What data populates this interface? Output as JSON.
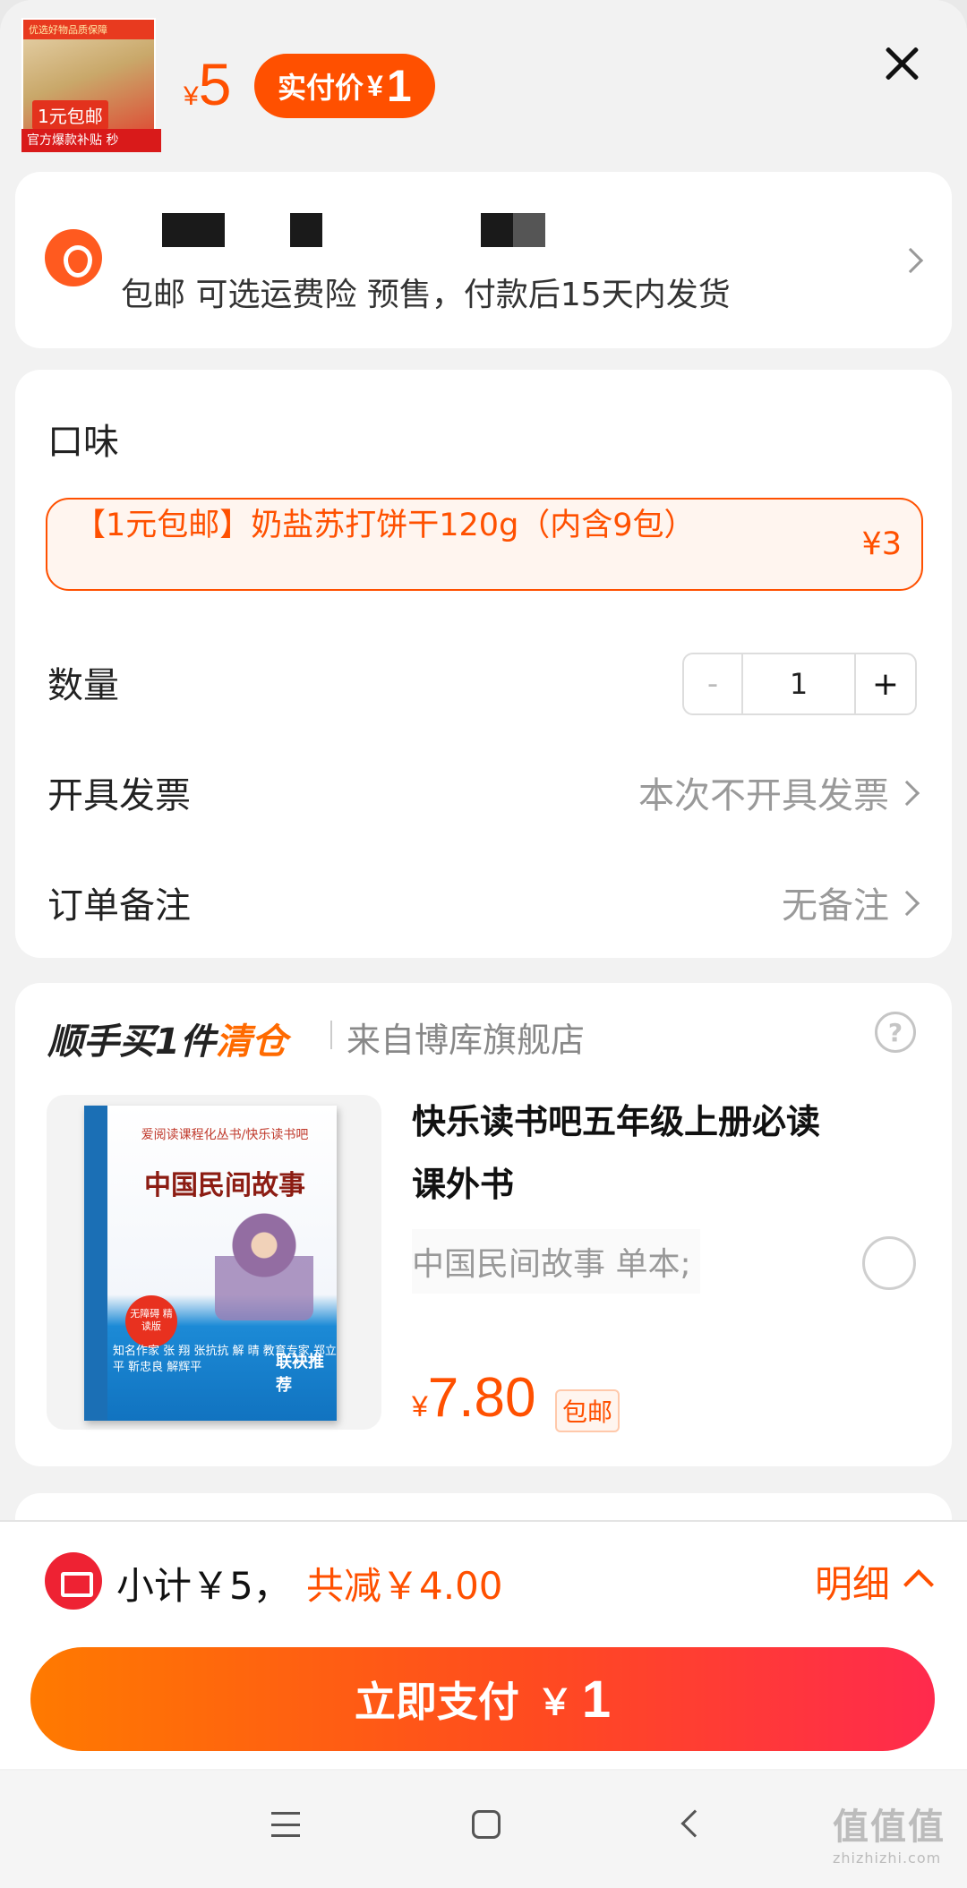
{
  "header": {
    "thumb_top_text": "优选好物品质保障",
    "thumb_badge": "1元包邮",
    "thumb_bottom": "官方爆款补贴 秒",
    "price_symbol": "¥",
    "price_value": "5",
    "paid_label": "实付价",
    "paid_symbol": "¥",
    "paid_value": "1"
  },
  "address": {
    "shipping_line": "包邮  可选运费险  预售，付款后15天内发货"
  },
  "options": {
    "flavor_label": "口味",
    "spec_text": "【1元包邮】奶盐苏打饼干120g（内含9包）",
    "spec_price": "¥3",
    "quantity_label": "数量",
    "quantity_minus": "-",
    "quantity_value": "1",
    "quantity_plus": "+",
    "invoice_label": "开具发票",
    "invoice_value": "本次不开具发票",
    "remark_label": "订单备注",
    "remark_value": "无备注"
  },
  "addon": {
    "title_prefix": "顺手买1件",
    "title_highlight": "清仓",
    "store": "来自博库旗舰店",
    "help": "?",
    "book": {
      "series": "爱阅读课程化丛书/快乐读书吧",
      "title": "中国民间故事",
      "badge": "无障碍 精读版",
      "blurb": "知名作家 张 翔 张抗抗 解 晴 教育专家 郑立平 靳忠良 解辉平",
      "strong": "联袂推荐"
    },
    "item_name": "快乐读书吧五年级上册必读课外书",
    "item_spec": "中国民间故事 单本;",
    "price_symbol": "¥",
    "price_value": "7.80",
    "ship_tag": "包邮"
  },
  "bottom": {
    "subtotal": "小计￥5，",
    "discount": "共减￥4.00",
    "detail": "明细",
    "pay_label": "立即支付",
    "pay_symbol": "￥",
    "pay_value": "1"
  },
  "watermark": {
    "text": "值值值",
    "url": "zhizhizhi.com"
  },
  "colors": {
    "accent": "#ff5000",
    "pay_gradient_start": "#ff7a00",
    "pay_gradient_end": "#ff2a4d"
  }
}
